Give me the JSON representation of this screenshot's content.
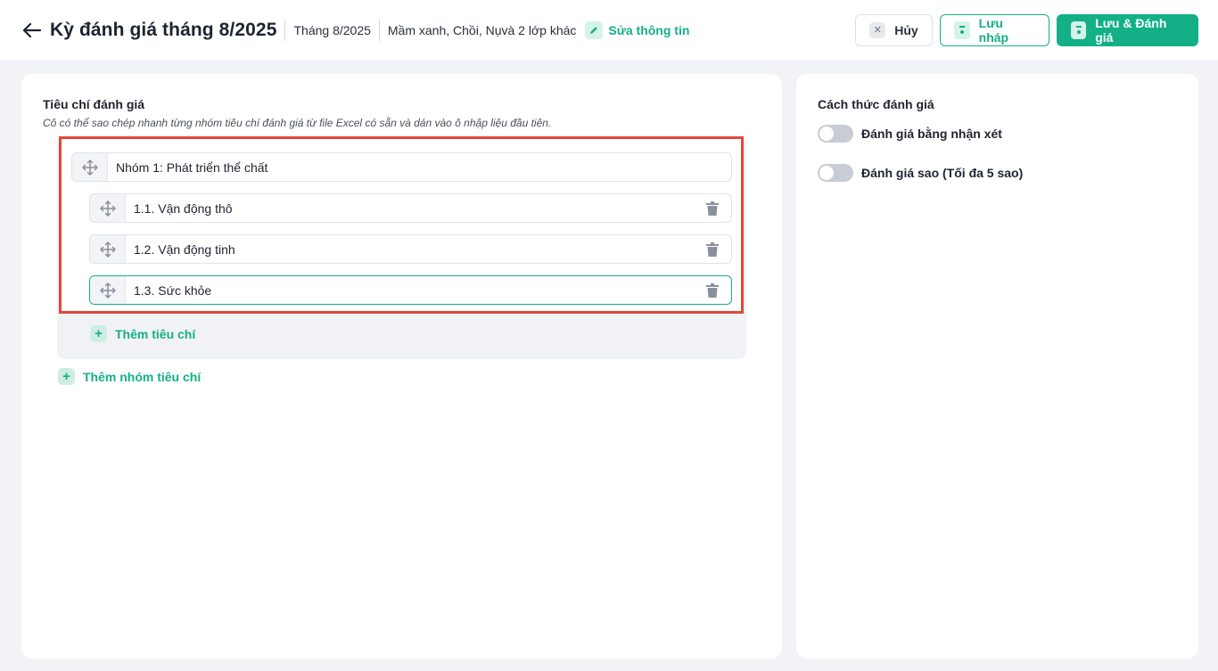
{
  "header": {
    "title": "Kỳ đánh giá tháng 8/2025",
    "month": "Tháng 8/2025",
    "classes": "Mầm xanh, Chồi, Nụvà 2 lớp khác",
    "edit_label": "Sửa thông tin",
    "cancel_label": "Hủy",
    "draft_label": "Lưu nháp",
    "save_label": "Lưu & Đánh giá"
  },
  "criteria": {
    "title": "Tiêu chí đánh giá",
    "hint": "Cô có thể sao chép nhanh từng nhóm tiêu chí đánh giá từ file Excel có sẵn và dán vào ô nhập liệu đầu tiên.",
    "group": {
      "name": "Nhóm 1: Phát triển thể chất",
      "items": [
        {
          "label": "1.1. Vận động thô"
        },
        {
          "label": "1.2. Vận động tinh"
        },
        {
          "label": "1.3. Sức khỏe"
        }
      ],
      "add_item_label": "Thêm tiêu chí"
    },
    "add_group_label": "Thêm nhóm tiêu chí"
  },
  "method": {
    "title": "Cách thức đánh giá",
    "options": [
      {
        "label": "Đánh giá bằng nhận xét",
        "enabled": false
      },
      {
        "label": "Đánh giá sao (Tối đa 5 sao)",
        "enabled": false
      }
    ]
  },
  "colors": {
    "accent": "#13b087",
    "highlight_border": "#e2473b",
    "background": "#f2f3f7"
  }
}
